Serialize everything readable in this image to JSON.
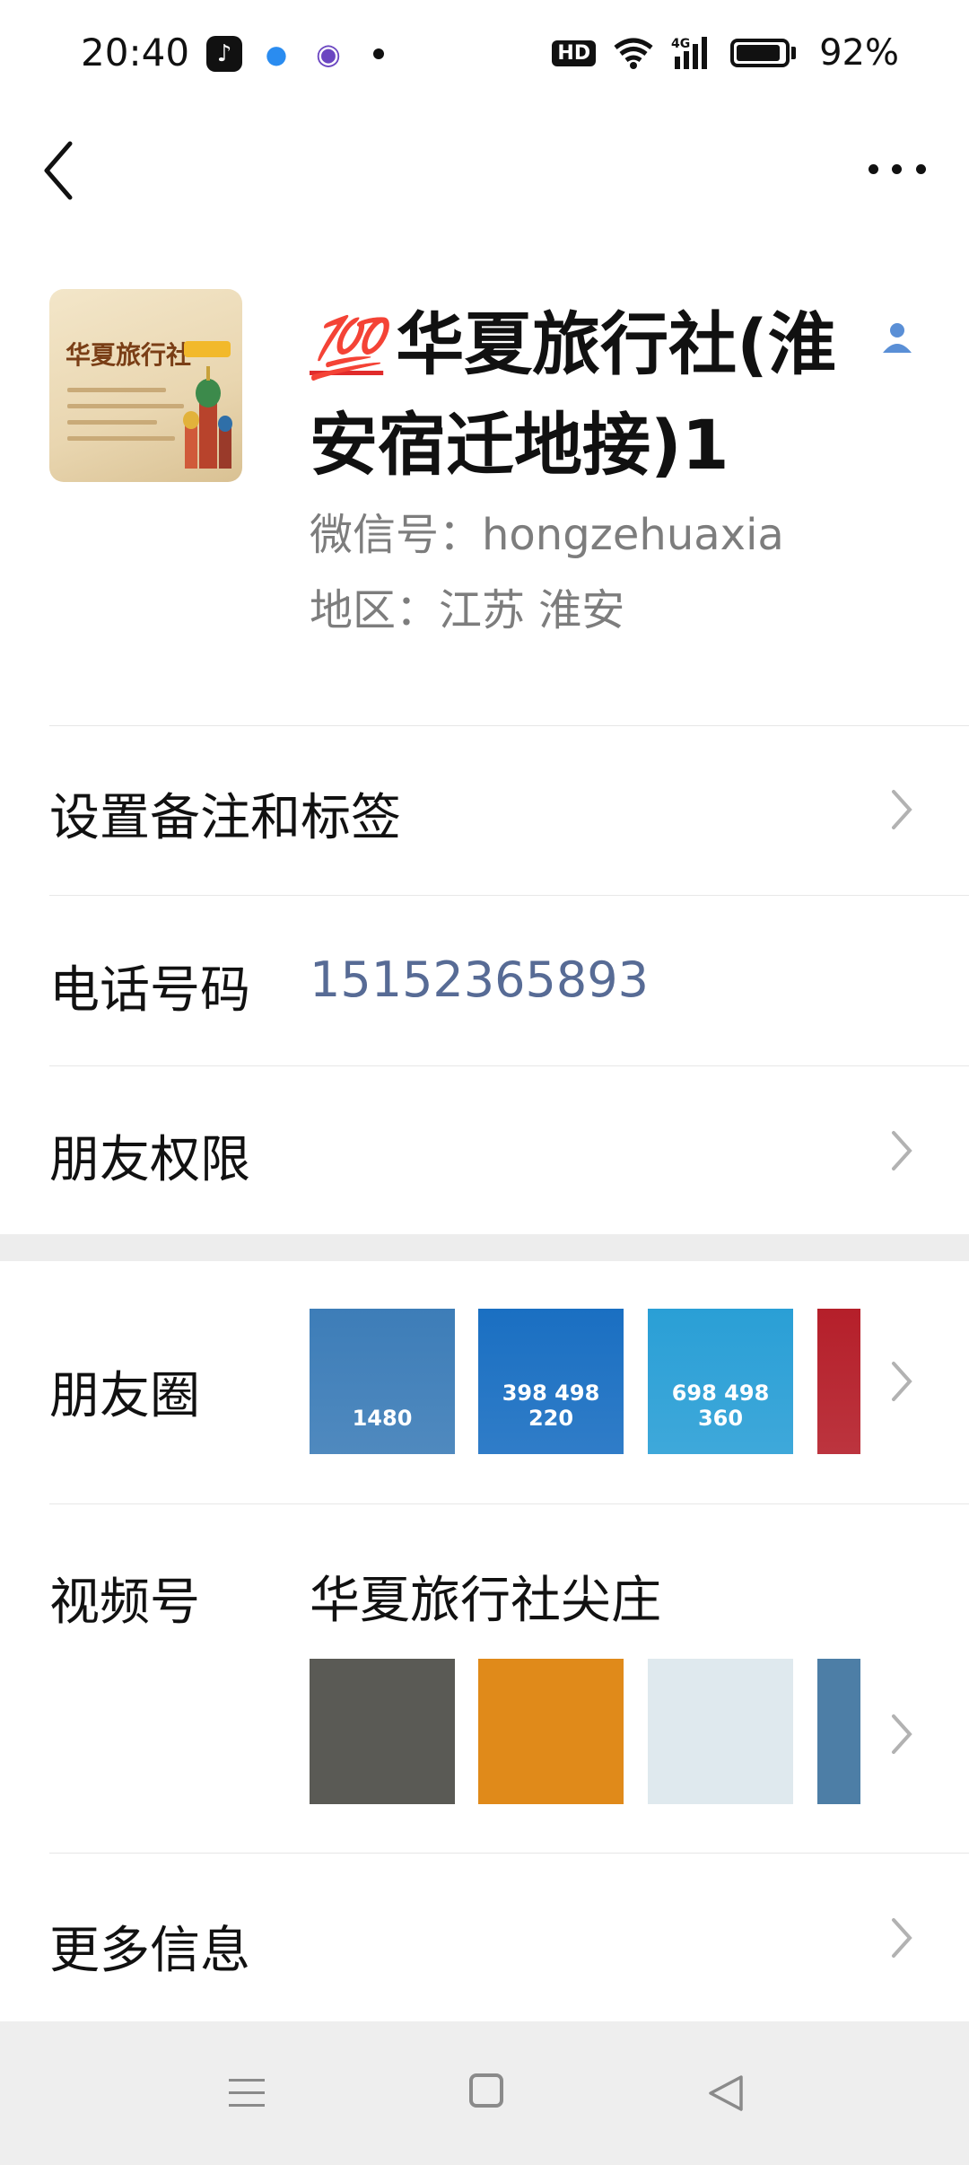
{
  "status_bar": {
    "time": "20:40",
    "hd_badge": "HD",
    "network": "4G",
    "battery_percent": "92%",
    "battery_level": 0.92,
    "app_icons": [
      "tiktok-icon",
      "search-app-icon",
      "planet-app-icon"
    ]
  },
  "nav": {
    "back_icon": "chevron-left-icon",
    "more_icon": "more-dots-icon"
  },
  "profile": {
    "avatar_text": "华夏旅行社",
    "name_emoji": "💯",
    "name": "华夏旅行社(淮安宿迁地接)1",
    "wechat_id": "微信号：hongzehuaxia",
    "region": "地区：江苏  淮安",
    "contact_icon": "person-icon"
  },
  "rows": {
    "remark_label": "设置备注和标签",
    "phone_label": "电话号码",
    "phone_value": "15152365893",
    "friend_perm_label": "朋友权限",
    "moments_label": "朋友圈",
    "channels_label": "视频号",
    "channels_name": "华夏旅行社尖庄",
    "more_info_label": "更多信息"
  },
  "moments_thumbs": [
    {
      "text": "1480",
      "color": "#3d7db8"
    },
    {
      "text": "398 498 220",
      "color": "#1a6fc2"
    },
    {
      "text": "698 498 360",
      "color": "#2a9fd6"
    },
    {
      "text": "",
      "color": "#b51f2a"
    }
  ],
  "channel_thumbs": [
    {
      "color": "#5a5a55"
    },
    {
      "color": "#e08a1a"
    },
    {
      "color": "#dfe9ee"
    },
    {
      "color": "#4d7ea6"
    }
  ],
  "colors": {
    "link": "#576b95",
    "secondary_text": "#7d7d7d",
    "section_gap": "#ededed",
    "system_nav_bg": "#eeeeee"
  }
}
